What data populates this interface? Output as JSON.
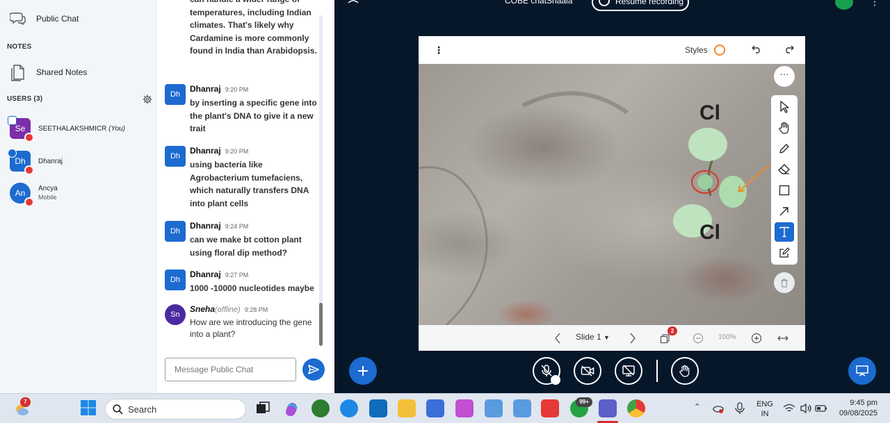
{
  "sidebar": {
    "public_chat": "Public Chat",
    "notes_header": "NOTES",
    "shared_notes": "Shared Notes",
    "users_header": "USERS (3)",
    "users": [
      {
        "initials": "Se",
        "name": "SEETHALAKSHMICR",
        "tag": "(You)",
        "color": "#7b2fa8"
      },
      {
        "initials": "Dh",
        "name": "Dhanraj",
        "color": "#1d6bd0"
      },
      {
        "initials": "An",
        "name": "Ancya",
        "sub": "Mobile",
        "color": "#1d6bd0"
      }
    ]
  },
  "chat": {
    "partial_text": "can handle a wider range of temperatures, including Indian climates. That's likely why Cardamine is more commonly found in India than Arabidopsis.",
    "messages": [
      {
        "initials": "Dh",
        "author": "Dhanraj",
        "time": "9:20 PM",
        "text": "by inserting a specific gene into the plant's DNA to give it a new trait"
      },
      {
        "initials": "Dh",
        "author": "Dhanraj",
        "time": "9:20 PM",
        "text": "using bacteria like Agrobacterium tumefaciens, which naturally transfers DNA into plant cells"
      },
      {
        "initials": "Dh",
        "author": "Dhanraj",
        "time": "9:24 PM",
        "text": "can we make bt cotton plant using floral dip method?"
      },
      {
        "initials": "Dh",
        "author": "Dhanraj",
        "time": "9:27 PM",
        "text": "1000 -10000 nucleotides maybe"
      },
      {
        "initials": "Sn",
        "author": "Sneha",
        "status": "(offline)",
        "time": "9:28 PM",
        "text": "How are we introducing the gene into a plant?"
      }
    ],
    "input_placeholder": "Message Public Chat"
  },
  "topbar": {
    "title": "COBE chatShaala",
    "resume_label": "Resume recording"
  },
  "whiteboard": {
    "styles_label": "Styles",
    "annotation_top": "Cl",
    "annotation_bottom": "Cl",
    "slide_label": "Slide 1",
    "zoom": "100%",
    "layers_badge": "2"
  },
  "taskbar": {
    "weather_badge": "7",
    "search_placeholder": "Search",
    "whatsapp_badge": "99+",
    "lang_top": "ENG",
    "lang_bottom": "IN",
    "time": "9:45 pm",
    "date": "09/08/2025"
  }
}
